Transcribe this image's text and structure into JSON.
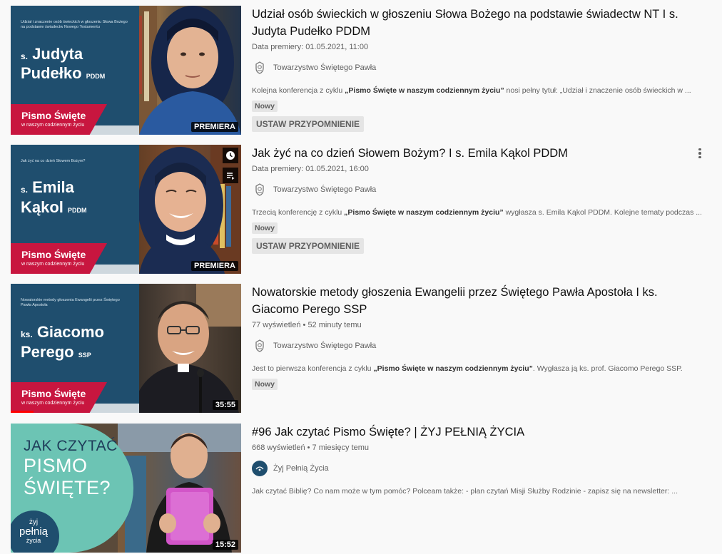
{
  "results": [
    {
      "title": "Udział osób świeckich w głoszeniu Słowa Bożego na podstawie świadectw NT I s. Judyta Pudełko PDDM",
      "meta": "Data premiery: 01.05.2021, 11:00",
      "channel": "Towarzystwo Świętego Pawła",
      "desc_pre": "Kolejna konferencja z cyklu ",
      "desc_bold": "„Pismo Święte w naszym codziennym życiu”",
      "desc_post": " nosi pełny tytuł: „Udział i znaczenie osób świeckich w ...",
      "badge": "Nowy",
      "button": "USTAW PRZYPOMNIENIE",
      "thumb": {
        "small": "Udział i znaczenie osób świeckich w głoszeniu Słowa Bożego na podstawie świadectw Nowego Testamentu",
        "prefix": "s.",
        "name1": "Judyta",
        "name2": "Pudełko",
        "suffix": "PDDM",
        "series": "Pismo Święte",
        "series_sub": "w naszym codziennym życiu",
        "label": "PREMIERA"
      }
    },
    {
      "title": "Jak żyć na co dzień Słowem Bożym? I s. Emila Kąkol PDDM",
      "meta": "Data premiery: 01.05.2021, 16:00",
      "channel": "Towarzystwo Świętego Pawła",
      "desc_pre": "Trzecią konferencję z cyklu ",
      "desc_bold": "„Pismo Święte w naszym codziennym życiu”",
      "desc_post": " wygłasza s. Emila Kąkol PDDM. Kolejne tematy podczas ...",
      "badge": "Nowy",
      "button": "USTAW PRZYPOMNIENIE",
      "thumb": {
        "small": "Jak żyć na co dzień Słowem Bożym?",
        "prefix": "s.",
        "name1": "Emila",
        "name2": "Kąkol",
        "suffix": "PDDM",
        "series": "Pismo Święte",
        "series_sub": "w naszym codziennym życiu",
        "label": "PREMIERA"
      }
    },
    {
      "title": "Nowatorskie metody głoszenia Ewangelii przez Świętego Pawła Apostoła I ks. Giacomo Perego SSP",
      "meta": "77 wyświetleń • 52 minuty temu",
      "channel": "Towarzystwo Świętego Pawła",
      "desc_pre": "Jest to pierwsza konferencja z cyklu ",
      "desc_bold": "„Pismo Święte w naszym codziennym życiu”",
      "desc_post": ". Wygłasza ją ks. prof. Giacomo Perego SSP.",
      "badge": "Nowy",
      "thumb": {
        "small": "Nowatorskie metody głoszenia Ewangelii przez Świętego Pawła Apostoła",
        "prefix": "ks.",
        "name1": "Giacomo",
        "name2": "Perego",
        "suffix": "SSP",
        "series": "Pismo Święte",
        "series_sub": "w naszym codziennym życiu",
        "label": "35:55",
        "watched_fraction": 0.1
      }
    },
    {
      "title": "#96 Jak czytać Pismo Święte? | ŻYJ PEŁNIĄ ŻYCIA",
      "meta": "668 wyświetleń • 7 miesięcy temu",
      "channel": "Żyj Pełnią Życia",
      "desc_pre": "Jak czytać Biblię? Co nam może w tym pomóc? Polceam także: - plan czytań Misji Służby Rodzinie - zapisz się na newsletter: ...",
      "desc_bold": "",
      "desc_post": "",
      "thumb": {
        "line1": "JAK CZYTAĆ",
        "line2": "PISMO",
        "line3": "ŚWIĘTE?",
        "logo1": "żyj",
        "logo2": "pełnią",
        "logo3": "życia",
        "label": "15:52"
      }
    }
  ],
  "colors": {
    "thumb_blue": "#1f4e6e",
    "series_red": "#c8163f",
    "teal": "#6cc4b4",
    "progress_red": "#ff0000"
  }
}
